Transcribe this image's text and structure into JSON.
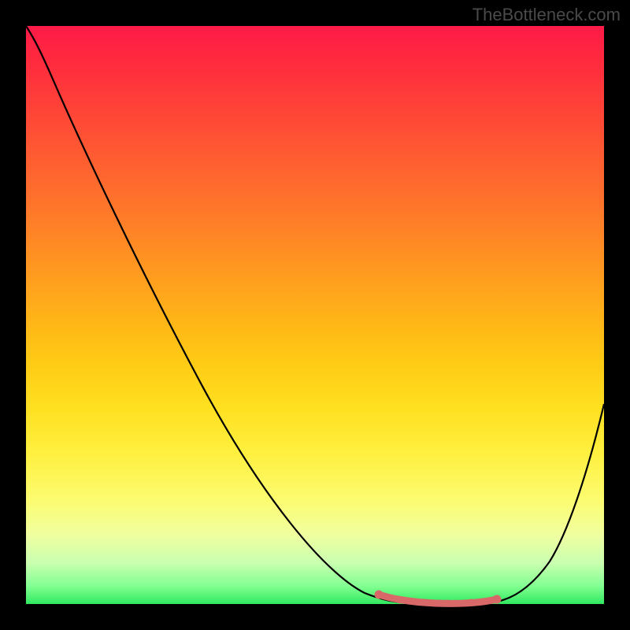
{
  "watermark": "TheBottleneck.com",
  "chart_data": {
    "type": "line",
    "title": "",
    "xlabel": "",
    "ylabel": "",
    "xlim": [
      0,
      100
    ],
    "ylim": [
      0,
      100
    ],
    "series": [
      {
        "name": "bottleneck-curve",
        "x": [
          0,
          5,
          10,
          15,
          20,
          25,
          30,
          35,
          40,
          45,
          50,
          55,
          60,
          62,
          65,
          68,
          70,
          73,
          76,
          80,
          82,
          85,
          90,
          95,
          100
        ],
        "y": [
          100,
          97,
          90,
          82,
          74,
          66,
          58,
          50,
          42,
          34,
          26,
          18,
          10,
          6,
          3,
          1,
          0,
          0,
          0,
          0,
          0.5,
          2,
          8,
          18,
          34
        ]
      }
    ],
    "optimal_range": {
      "x_start": 62,
      "x_end": 82
    },
    "gradient_stops": [
      {
        "pos": 0,
        "color": "#ff1a48"
      },
      {
        "pos": 50,
        "color": "#ffb218"
      },
      {
        "pos": 82,
        "color": "#fcfc70"
      },
      {
        "pos": 100,
        "color": "#30e860"
      }
    ]
  }
}
